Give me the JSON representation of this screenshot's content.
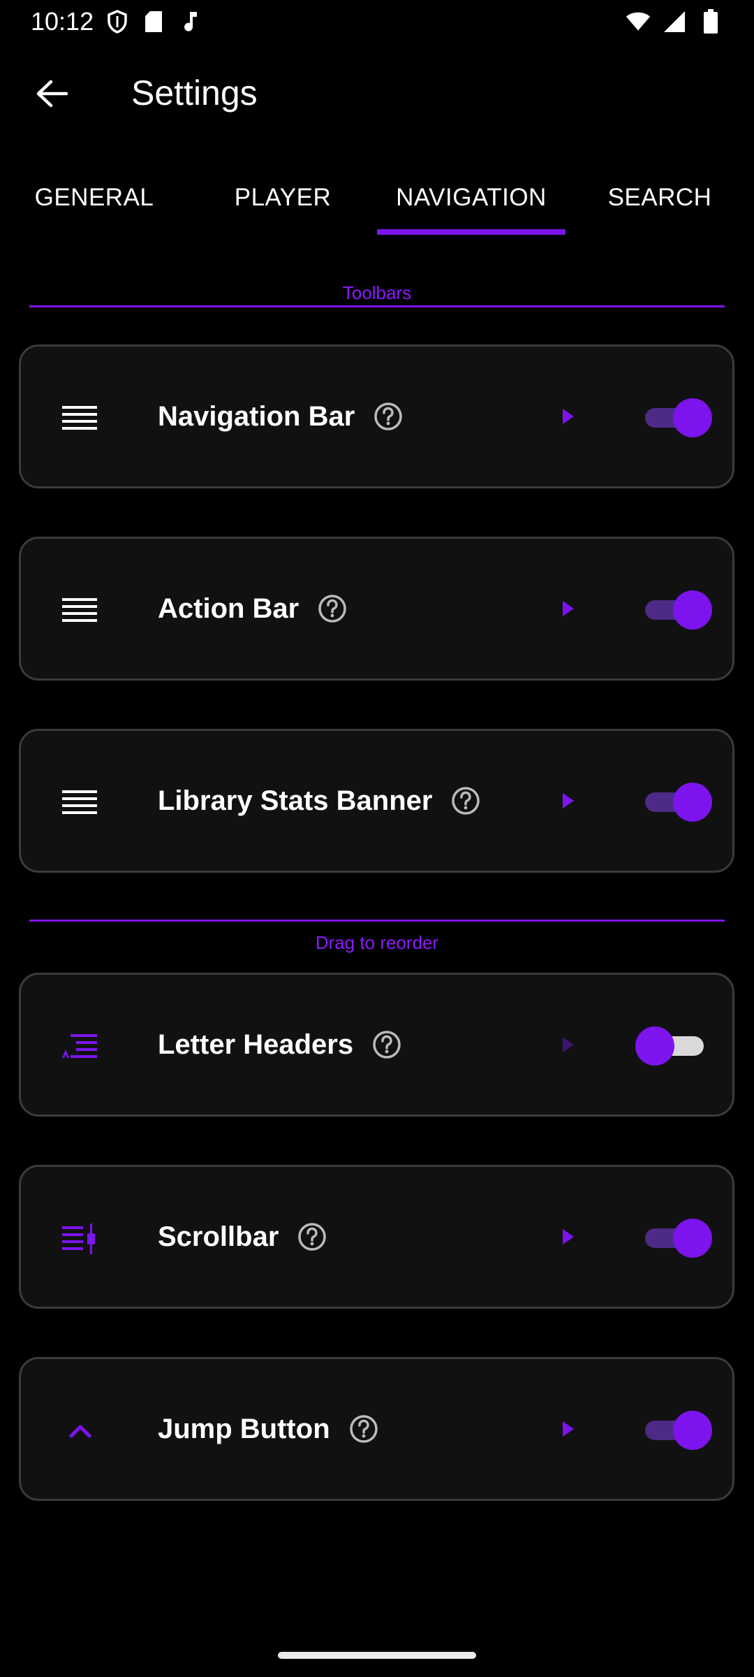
{
  "status_bar": {
    "time": "10:12",
    "left_icons": [
      "shield-icon",
      "sd-card-icon",
      "music-note-icon"
    ],
    "right_icons": [
      "wifi-icon",
      "cell-signal-icon",
      "battery-icon"
    ]
  },
  "app_bar": {
    "title": "Settings",
    "back_icon": "arrow-back-icon"
  },
  "tabs": [
    {
      "label": "GENERAL",
      "active": false
    },
    {
      "label": "PLAYER",
      "active": false
    },
    {
      "label": "NAVIGATION",
      "active": true
    },
    {
      "label": "SEARCH",
      "active": false
    }
  ],
  "sections": {
    "toolbars": "Toolbars",
    "reorder": "Drag to reorder"
  },
  "items": [
    {
      "label": "Navigation Bar",
      "icon": "drag-handle-icon",
      "enabled": true
    },
    {
      "label": "Action Bar",
      "icon": "drag-handle-icon",
      "enabled": true
    },
    {
      "label": "Library Stats Banner",
      "icon": "drag-handle-icon",
      "enabled": true
    },
    {
      "label": "Letter Headers",
      "icon": "letter-headers-icon",
      "enabled": false
    },
    {
      "label": "Scrollbar",
      "icon": "scrollbar-icon",
      "enabled": true
    },
    {
      "label": "Jump Button",
      "icon": "chevron-up-icon",
      "enabled": true
    }
  ],
  "colors": {
    "accent": "#7d14ee",
    "background": "#000000",
    "card": "#111111",
    "card_border": "#3b3b3b"
  }
}
